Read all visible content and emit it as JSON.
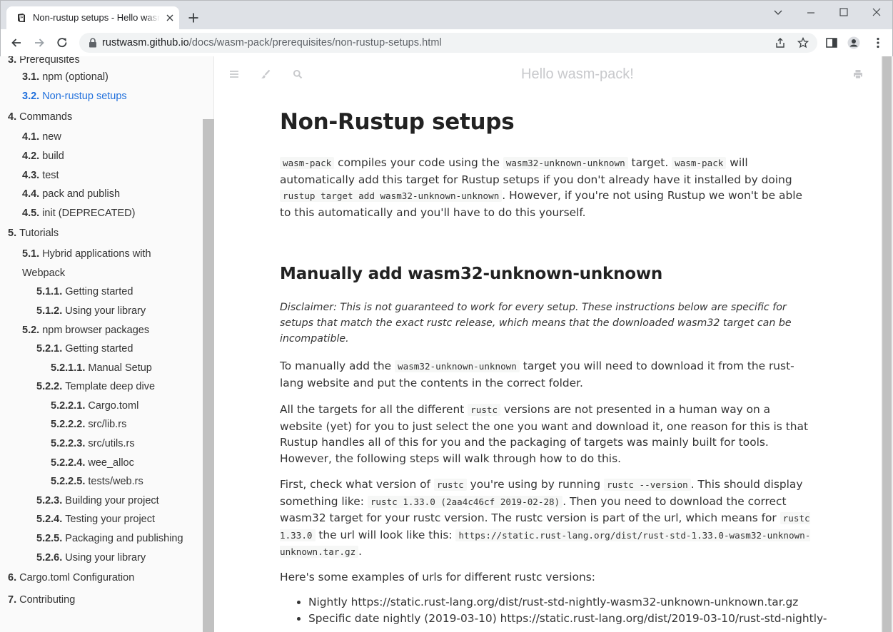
{
  "browser": {
    "tab_title": "Non-rustup setups - Hello wasm-pack!",
    "url_host": "rustwasm.github.io",
    "url_path": "/docs/wasm-pack/prerequisites/non-rustup-setups.html"
  },
  "menubar": {
    "title": "Hello wasm-pack!"
  },
  "toc": [
    {
      "num": "3.",
      "label": "Prerequisites",
      "active": false
    },
    {
      "num": "3.1.",
      "label": "npm (optional)",
      "active": false
    },
    {
      "num": "3.2.",
      "label": "Non-rustup setups",
      "active": true
    },
    {
      "num": "4.",
      "label": "Commands",
      "active": false
    },
    {
      "num": "4.1.",
      "label": "new",
      "active": false
    },
    {
      "num": "4.2.",
      "label": "build",
      "active": false
    },
    {
      "num": "4.3.",
      "label": "test",
      "active": false
    },
    {
      "num": "4.4.",
      "label": "pack and publish",
      "active": false
    },
    {
      "num": "4.5.",
      "label": "init (DEPRECATED)",
      "active": false
    },
    {
      "num": "5.",
      "label": "Tutorials",
      "active": false
    },
    {
      "num": "5.1.",
      "label": "Hybrid applications with",
      "active": false
    },
    {
      "num": "",
      "label": "Webpack",
      "active": false
    },
    {
      "num": "5.1.1.",
      "label": "Getting started",
      "active": false
    },
    {
      "num": "5.1.2.",
      "label": "Using your library",
      "active": false
    },
    {
      "num": "5.2.",
      "label": "npm browser packages",
      "active": false
    },
    {
      "num": "5.2.1.",
      "label": "Getting started",
      "active": false
    },
    {
      "num": "5.2.1.1.",
      "label": "Manual Setup",
      "active": false
    },
    {
      "num": "5.2.2.",
      "label": "Template deep dive",
      "active": false
    },
    {
      "num": "5.2.2.1.",
      "label": "Cargo.toml",
      "active": false
    },
    {
      "num": "5.2.2.2.",
      "label": "src/lib.rs",
      "active": false
    },
    {
      "num": "5.2.2.3.",
      "label": "src/utils.rs",
      "active": false
    },
    {
      "num": "5.2.2.4.",
      "label": "wee_alloc",
      "active": false
    },
    {
      "num": "5.2.2.5.",
      "label": "tests/web.rs",
      "active": false
    },
    {
      "num": "5.2.3.",
      "label": "Building your project",
      "active": false
    },
    {
      "num": "5.2.4.",
      "label": "Testing your project",
      "active": false
    },
    {
      "num": "5.2.5.",
      "label": "Packaging and publishing",
      "active": false
    },
    {
      "num": "5.2.6.",
      "label": "Using your library",
      "active": false
    },
    {
      "num": "6.",
      "label": "Cargo.toml Configuration",
      "active": false
    },
    {
      "num": "7.",
      "label": "Contributing",
      "active": false
    }
  ],
  "article": {
    "title": "Non-Rustup setups",
    "intro": [
      {
        "code": "wasm-pack"
      },
      {
        "text": " compiles your code using the "
      },
      {
        "code": "wasm32-unknown-unknown"
      },
      {
        "text": " target. "
      },
      {
        "code": "wasm-pack"
      },
      {
        "text": " will automatically add this target for Rustup setups if you don't already have it installed by doing "
      },
      {
        "code": "rustup target add wasm32-unknown-unknown"
      },
      {
        "text": ". However, if you're not using Rustup we won't be able to this automatically and you'll have to do this yourself."
      }
    ],
    "heading": "Manually add wasm32-unknown-unknown",
    "disclaimer": "Disclaimer: This is not guaranteed to work for every setup. These instructions below are specific for setups that match the exact rustc release, which means that the downloaded wasm32 target can be incompatible.",
    "p_manual": [
      {
        "text": "To manually add the "
      },
      {
        "code": "wasm32-unknown-unknown"
      },
      {
        "text": " target you will need to download it from the rust-lang website and put the contents in the correct folder."
      }
    ],
    "p_targets": [
      {
        "text": "All the targets for all the different "
      },
      {
        "code": "rustc"
      },
      {
        "text": " versions are not presented in a human way on a website (yet) for you to just select the one you want and download it, one reason for this is that Rustup handles all of this for you and the packaging of targets was mainly built for tools. However, the following steps will walk through how to do this."
      }
    ],
    "p_first": [
      {
        "text": "First, check what version of "
      },
      {
        "code": "rustc"
      },
      {
        "text": " you're using by running "
      },
      {
        "code": "rustc --version"
      },
      {
        "text": ". This should display something like: "
      },
      {
        "code": "rustc 1.33.0 (2aa4c46cf 2019-02-28)"
      },
      {
        "text": ". Then you need to download the correct wasm32 target for your rustc version. The rustc version is part of the url, which means for "
      },
      {
        "code": "rustc 1.33.0"
      },
      {
        "text": " the url will look like this: "
      },
      {
        "code": "https://static.rust-lang.org/dist/rust-std-1.33.0-wasm32-unknown-unknown.tar.gz"
      },
      {
        "text": "."
      }
    ],
    "p_examples": "Here's some examples of urls for different rustc versions:",
    "examples": [
      "Nightly https://static.rust-lang.org/dist/rust-std-nightly-wasm32-unknown-unknown.tar.gz",
      "Specific date nightly (2019-03-10) https://static.rust-lang.org/dist/2019-03-10/rust-std-nightly-"
    ]
  }
}
